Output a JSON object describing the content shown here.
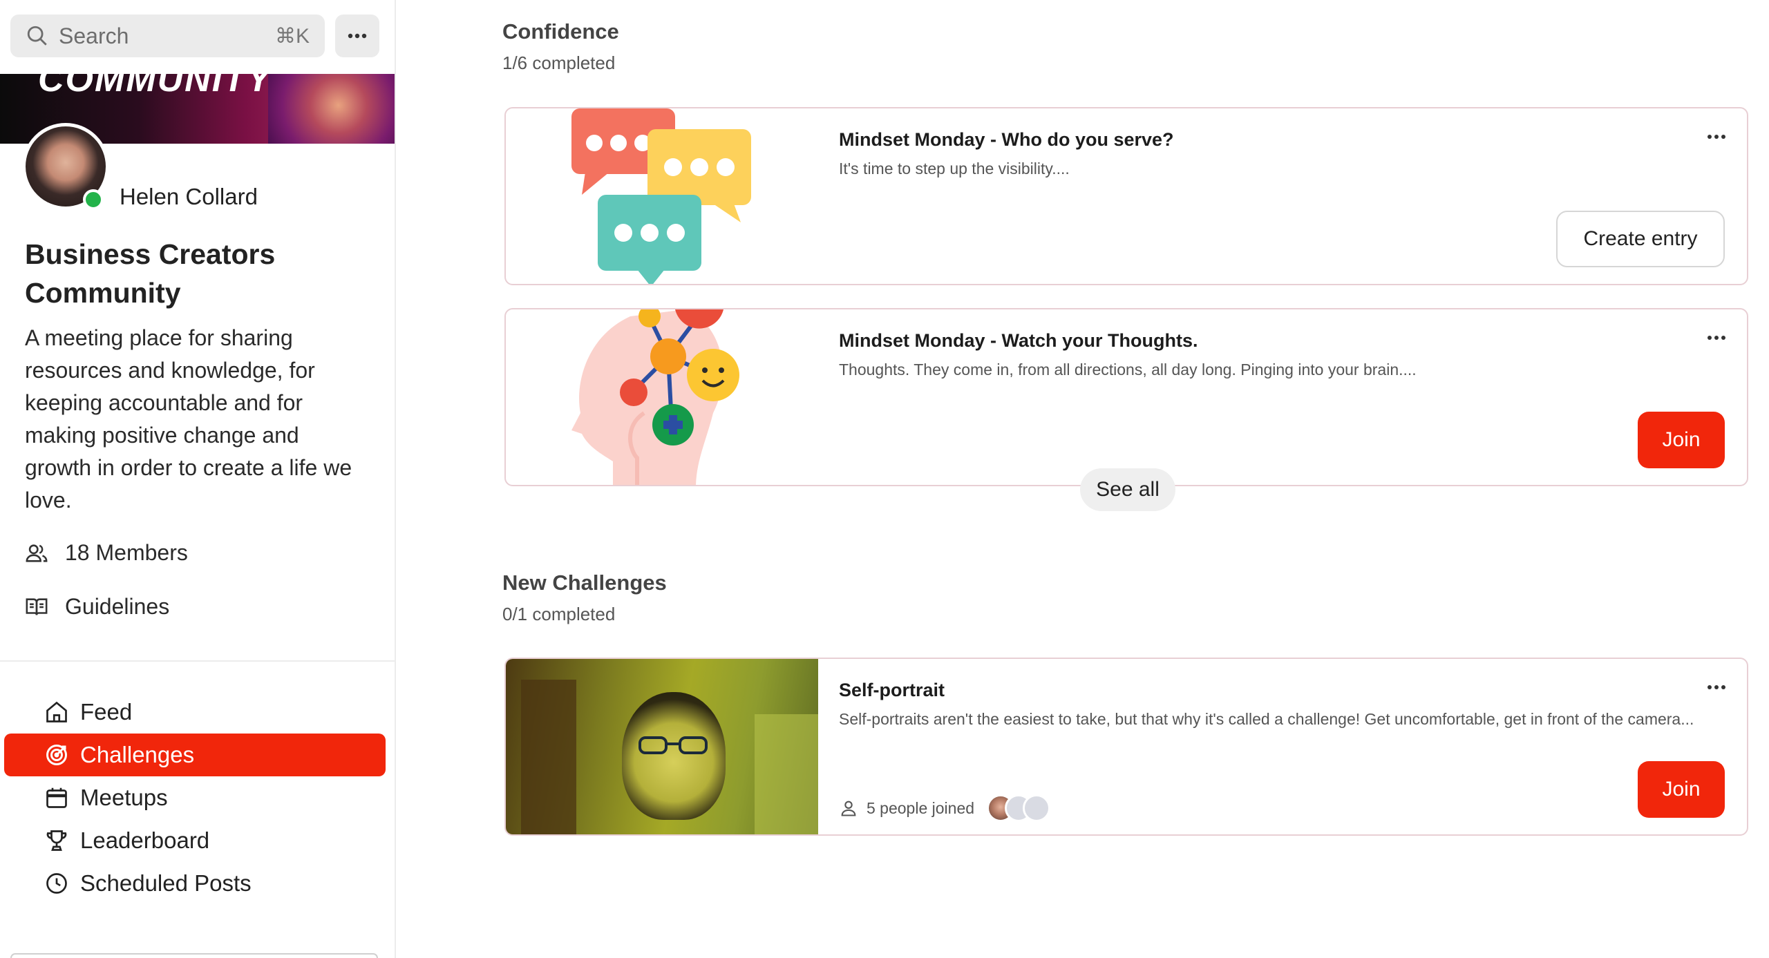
{
  "search": {
    "placeholder": "Search",
    "shortcut": "⌘K"
  },
  "sidebar": {
    "banner_text": "COMMUNITY",
    "owner_name": "Helen Collard",
    "owner_online": true,
    "community_title": "Business Creators Community",
    "community_description": "A meeting place for sharing resources and knowledge, for keeping accountable and for making positive change and growth in order to create a life we love.",
    "members_label": "18 Members",
    "guidelines_label": "Guidelines",
    "nav": [
      {
        "label": "Feed",
        "icon": "home-icon",
        "active": false
      },
      {
        "label": "Challenges",
        "icon": "target-icon",
        "active": true
      },
      {
        "label": "Meetups",
        "icon": "calendar-icon",
        "active": false
      },
      {
        "label": "Leaderboard",
        "icon": "trophy-icon",
        "active": false
      },
      {
        "label": "Scheduled Posts",
        "icon": "clock-icon",
        "active": false
      }
    ]
  },
  "sections": [
    {
      "title": "Confidence",
      "progress": "1/6 completed",
      "cards": [
        {
          "title": "Mindset Monday - Who do you serve?",
          "description": "It's time to step up the visibility....",
          "button": "Create entry",
          "art": "speech-bubbles-illustration"
        },
        {
          "title": "Mindset Monday - Watch your Thoughts.",
          "description": "Thoughts. They come in, from all directions, all day long. Pinging into your brain....",
          "button": "Join",
          "art": "head-thoughts-illustration"
        }
      ],
      "see_all": "See all"
    },
    {
      "title": "New Challenges",
      "progress": "0/1 completed",
      "cards": [
        {
          "title": "Self-portrait",
          "description": "Self-portraits aren't the easiest to take, but that why it's called a challenge! Get uncomfortable, get in front of the camera...",
          "joined": "5 people joined",
          "button": "Join",
          "art": "self-portrait-photo"
        }
      ]
    }
  ],
  "colors": {
    "accent": "#f1260b",
    "online": "#23b34a",
    "card_border": "#e8cfd4"
  }
}
